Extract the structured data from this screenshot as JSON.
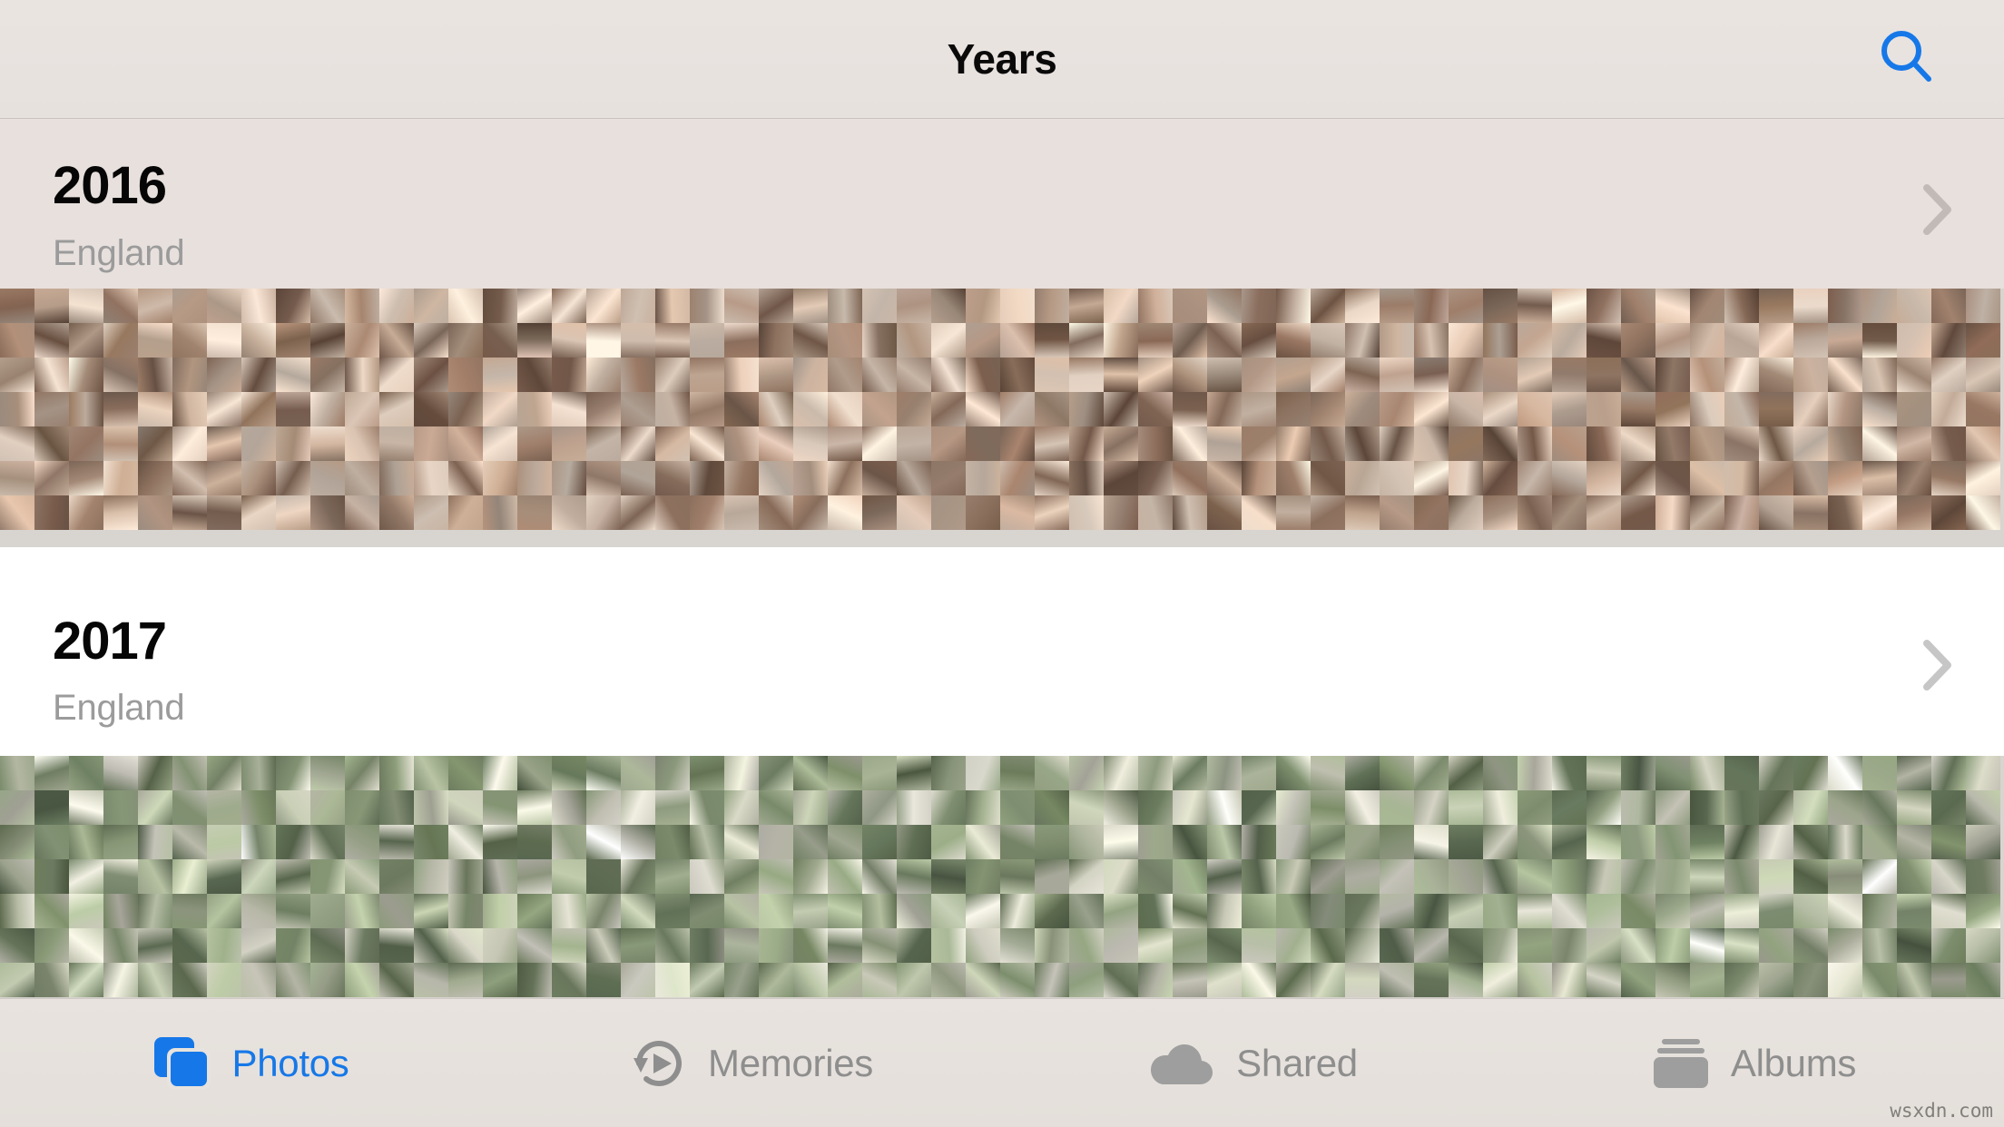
{
  "window": {
    "app_name": "Photos",
    "screen_name": "Years"
  },
  "navbar": {
    "title": "Years",
    "search_icon": "search-icon",
    "search_icon_color": "#1678E8",
    "background_color": "#E8E2DF"
  },
  "sections": [
    {
      "year": "2016",
      "location": "England",
      "chevron_icon": "chevron-right-icon",
      "header_background": "#E7E0DD",
      "header_text_color": "#060606",
      "subtitle_color": "#9b9b9b"
    },
    {
      "year": "2017",
      "location": "England",
      "chevron_icon": "chevron-right-icon",
      "header_background": "#FFFFFF",
      "header_text_color": "#060606",
      "subtitle_color": "#9b9b9b"
    }
  ],
  "tabbar": {
    "background_color": "#E6E1DC",
    "active_color": "#1678E8",
    "inactive_color": "#8E8E8E",
    "tabs": [
      {
        "label": "Photos",
        "icon": "photos-stack-icon",
        "active": true
      },
      {
        "label": "Memories",
        "icon": "memories-replay-icon",
        "active": false
      },
      {
        "label": "Shared",
        "icon": "cloud-icon",
        "active": false
      },
      {
        "label": "Albums",
        "icon": "albums-stack-icon",
        "active": false
      }
    ]
  },
  "watermark": {
    "text": "wsxdn.com"
  },
  "mosaics": {
    "y2016": {
      "columns": 58,
      "rows": 7,
      "cell_size": 38,
      "palette": [
        "#b8a698",
        "#d9c3b2",
        "#8e6f5c",
        "#c9b0a2",
        "#a98d7b",
        "#e2d0c2",
        "#7a5c4c",
        "#d6bfae",
        "#9e8473",
        "#c4a893",
        "#ecdccd",
        "#6f5445",
        "#bfa18d",
        "#d3b9a6",
        "#8b7363",
        "#e6d4c4",
        "#a3826d",
        "#cbb39f",
        "#7e6354",
        "#dcc7b6",
        "#b39b88",
        "#9c7e6a",
        "#e0cfc0",
        "#876c5b",
        "#c7ae99",
        "#d8c5b4",
        "#705544",
        "#b59a85",
        "#e9d9ca",
        "#957a67",
        "#cbb6a4",
        "#a48b78",
        "#7c6050",
        "#dfcdbd",
        "#bda48f",
        "#90735f",
        "#d2bca9",
        "#e4d3c3",
        "#836852",
        "#ab9180",
        "#c6ab96",
        "#745a49",
        "#d5c0af",
        "#9a8270",
        "#e8d7c7",
        "#b19680",
        "#8a6e5c",
        "#cdb5a1",
        "#dbc8b7",
        "#7f6455"
      ]
    },
    "y2017": {
      "columns": 58,
      "rows": 7,
      "cell_size": 38,
      "palette": [
        "#8c9b7a",
        "#b5bfa3",
        "#6f7f62",
        "#c6c7b4",
        "#92a083",
        "#d4d2c4",
        "#5f6e55",
        "#a8b395",
        "#7e8d6e",
        "#bfc6ae",
        "#e0ded2",
        "#6a7a5e",
        "#9eac8c",
        "#b2b9a0",
        "#80906f",
        "#d0cec0",
        "#748466",
        "#aab598",
        "#5a6a52",
        "#c9c9b8",
        "#96a486",
        "#7a8a6c",
        "#bdc4ab",
        "#e3e1d6",
        "#697858",
        "#a4b190",
        "#cdcdbd",
        "#5d6d54",
        "#b8c0a7",
        "#8a9a79",
        "#d7d6c8",
        "#71815f",
        "#a1ae8f",
        "#cbcbba",
        "#647454",
        "#aeb89b",
        "#889878",
        "#c4c9b1",
        "#e6e4d9",
        "#5c6c51",
        "#9aa888",
        "#d2d1c3",
        "#76866a",
        "#b0b9a2",
        "#7d8d70",
        "#c7c8b6",
        "#6d7d5f",
        "#a6b292",
        "#dcdace",
        "#849473"
      ]
    }
  }
}
